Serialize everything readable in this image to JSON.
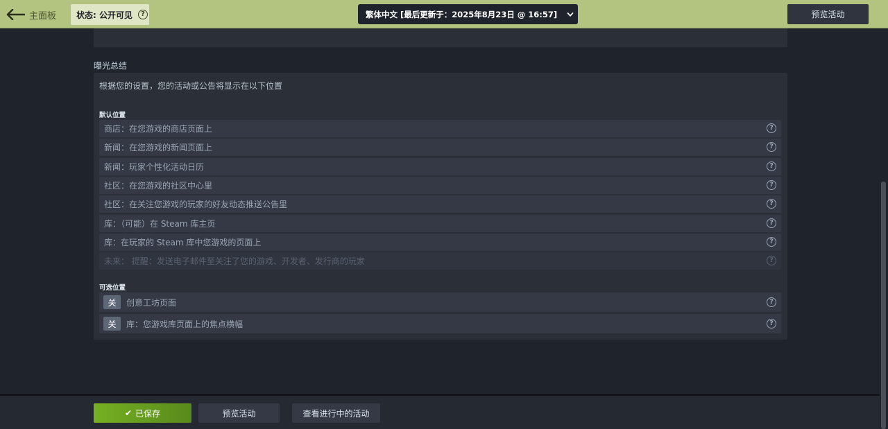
{
  "header": {
    "back_label": "主面板",
    "status_label": "状态: 公开可见",
    "language_select": "繁体中文 [最后更新于：2025年8月23日 @ 16:57]",
    "preview_label": "预览活动"
  },
  "summary": {
    "title": "曝光总结",
    "description": "根据您的设置，您的活动或公告将显示在以下位置",
    "default_label": "默认位置",
    "default_rows": [
      "商店：在您游戏的商店页面上",
      "新闻：在您游戏的新闻页面上",
      "新闻：玩家个性化活动日历",
      "社区：在您游戏的社区中心里",
      "社区：在关注您游戏的玩家的好友动态推送公告里",
      "库：（可能）在 Steam 库主页",
      "库：在玩家的 Steam 库中您游戏的页面上",
      "未来： 提醒：发送电子邮件至关注了您的游戏、开发者、发行商的玩家"
    ],
    "optional_label": "可选位置",
    "optional_rows": [
      {
        "toggle": "关",
        "label": "创意工坊页面"
      },
      {
        "toggle": "关",
        "label": "库：您游戏库页面上的焦点横幅"
      }
    ]
  },
  "footer": {
    "saved_label": "已保存",
    "preview_label": "预览活动",
    "ongoing_label": "查看进行中的活动"
  },
  "icons": {
    "help": "?",
    "check": "✔"
  },
  "colors": {
    "topbar": "#b3c380",
    "background": "#1f232b",
    "panel": "#2b2f38",
    "row": "#343945",
    "saved_green": "#75b022"
  }
}
